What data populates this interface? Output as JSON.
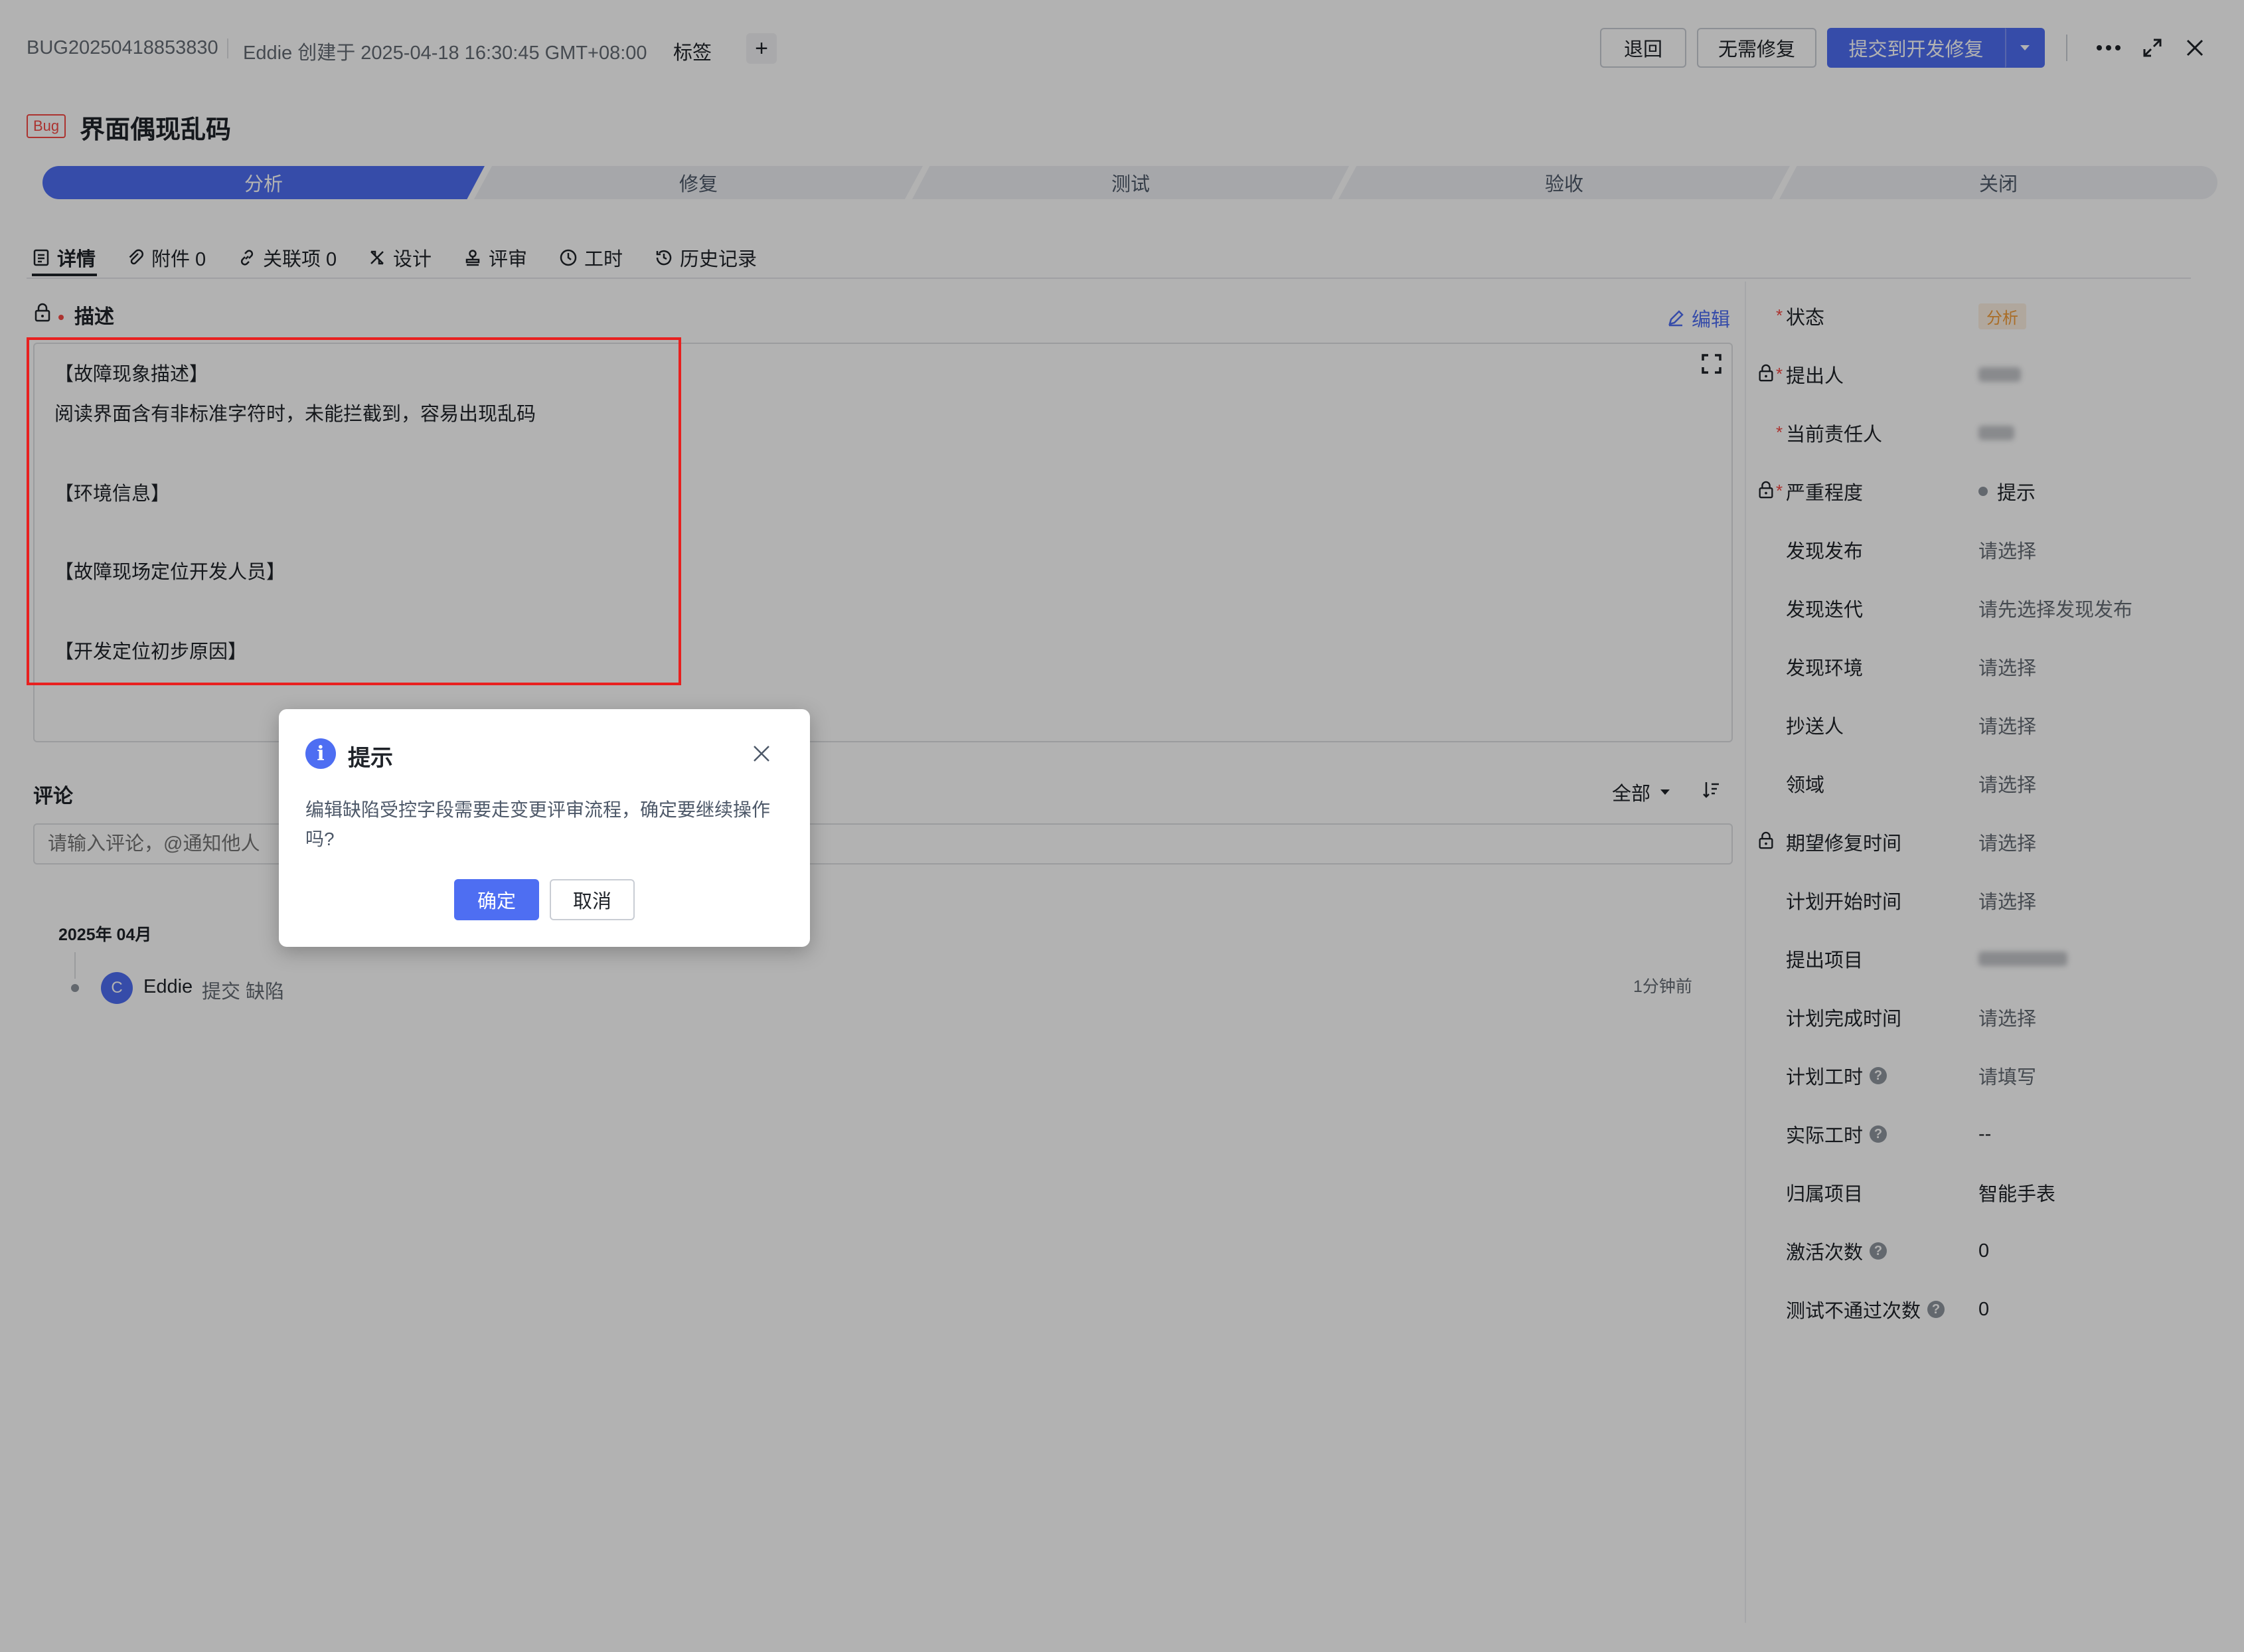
{
  "header": {
    "bug_id": "BUG20250418853830",
    "created_info": "Eddie 创建于 2025-04-18 16:30:45 GMT+08:00",
    "tag_label": "标签",
    "add_tag": "+",
    "buttons": {
      "return": "退回",
      "no_fix": "无需修复",
      "submit": "提交到开发修复"
    }
  },
  "title": {
    "badge": "Bug",
    "text": "界面偶现乱码"
  },
  "stages": [
    "分析",
    "修复",
    "测试",
    "验收",
    "关闭"
  ],
  "tabs": [
    {
      "label": "详情",
      "icon": "document-icon"
    },
    {
      "label": "附件 0",
      "icon": "paperclip-icon"
    },
    {
      "label": "关联项 0",
      "icon": "link-icon"
    },
    {
      "label": "设计",
      "icon": "design-icon"
    },
    {
      "label": "评审",
      "icon": "stamp-icon"
    },
    {
      "label": "工时",
      "icon": "clock-icon"
    },
    {
      "label": "历史记录",
      "icon": "history-icon"
    }
  ],
  "description": {
    "label": "描述",
    "edit": "编辑",
    "lines": [
      "【故障现象描述】",
      "阅读界面含有非标准字符时，未能拦截到，容易出现乱码",
      "【环境信息】",
      "【故障现场定位开发人员】",
      "【开发定位初步原因】"
    ]
  },
  "comments": {
    "label": "评论",
    "filter": "全部",
    "placeholder": "请输入评论，@通知他人",
    "month": "2025年 04月",
    "entry": {
      "avatar": "C",
      "user": "Eddie",
      "action": "提交 缺陷",
      "time": "1分钟前"
    }
  },
  "fields": [
    {
      "label": "状态",
      "value": "分析",
      "required": true
    },
    {
      "label": "提出人",
      "value": "",
      "required": true,
      "locked": true
    },
    {
      "label": "当前责任人",
      "value": "",
      "required": true
    },
    {
      "label": "严重程度",
      "value": "提示",
      "required": true,
      "locked": true
    },
    {
      "label": "发现发布",
      "value": "请选择"
    },
    {
      "label": "发现迭代",
      "value": "请先选择发现发布"
    },
    {
      "label": "发现环境",
      "value": "请选择"
    },
    {
      "label": "抄送人",
      "value": "请选择"
    },
    {
      "label": "领域",
      "value": "请选择"
    },
    {
      "label": "期望修复时间",
      "value": "请选择",
      "locked": true
    },
    {
      "label": "计划开始时间",
      "value": "请选择"
    },
    {
      "label": "提出项目",
      "value": ""
    },
    {
      "label": "计划完成时间",
      "value": "请选择"
    },
    {
      "label": "计划工时",
      "value": "请填写",
      "help": true
    },
    {
      "label": "实际工时",
      "value": "--",
      "help": true
    },
    {
      "label": "归属项目",
      "value": "智能手表"
    },
    {
      "label": "激活次数",
      "value": "0",
      "help": true
    },
    {
      "label": "测试不通过次数",
      "value": "0",
      "help": true
    }
  ],
  "dialog": {
    "title": "提示",
    "message": "编辑缺陷受控字段需要走变更评审流程，确定要继续操作吗?",
    "confirm": "确定",
    "cancel": "取消"
  },
  "colors": {
    "primary": "#4e6ef2",
    "highlight_box": "#e8201f",
    "status_badge": "#f39c38"
  }
}
